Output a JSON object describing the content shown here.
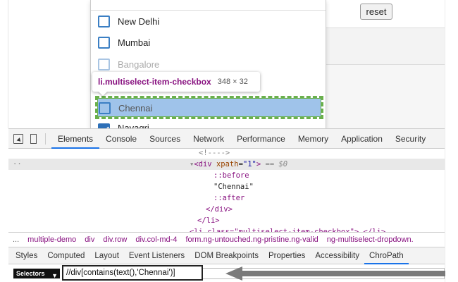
{
  "page": {
    "reset_label": "reset",
    "dropdown_items": [
      {
        "label": "New Delhi",
        "state": "unchecked"
      },
      {
        "label": "Mumbai",
        "state": "unchecked"
      },
      {
        "label": "Bangalore",
        "state": "faded"
      },
      {
        "label": "Chennai",
        "state": "highlighted"
      },
      {
        "label": "Navagri",
        "state": "checked"
      }
    ]
  },
  "tooltip": {
    "selector": "li.multiselect-item-checkbox",
    "size": "348 × 32"
  },
  "devtools": {
    "tabs": [
      "Elements",
      "Console",
      "Sources",
      "Network",
      "Performance",
      "Memory",
      "Application",
      "Security"
    ],
    "active_tab": "Elements",
    "dom": {
      "comment": "<!---->",
      "ellipsis": "··",
      "div_open_tag": "<div",
      "attr_name": " xpath",
      "attr_eq": "=",
      "attr_value": "\"1\"",
      "div_open_end": ">",
      "selected_marker": " == $0",
      "before": "::before",
      "text_node": "\"Chennai\"",
      "after": "::after",
      "div_close": "</div>",
      "li_close": "</li>",
      "next_line": "<li class=\"multiselect-item-checkbox\"> </li>"
    },
    "breadcrumbs": [
      "...",
      "multiple-demo",
      "div",
      "div.row",
      "div.col-md-4",
      "form.ng-untouched.ng-pristine.ng-valid",
      "ng-multiselect-dropdown."
    ],
    "sub_tabs": [
      "Styles",
      "Computed",
      "Layout",
      "Event Listeners",
      "DOM Breakpoints",
      "Properties",
      "Accessibility",
      "ChroPath"
    ],
    "active_sub_tab": "ChroPath",
    "chropath": {
      "selector_type": "Selectors",
      "xpath_value": "//div[contains(text(),'Chennai')]"
    }
  },
  "colors": {
    "highlight": "#9fc3ea",
    "highlight_border": "#6ab04c",
    "checkbox": "#3b7fc4",
    "tag": "#881280",
    "active_tab_underline": "#1a73e8"
  }
}
